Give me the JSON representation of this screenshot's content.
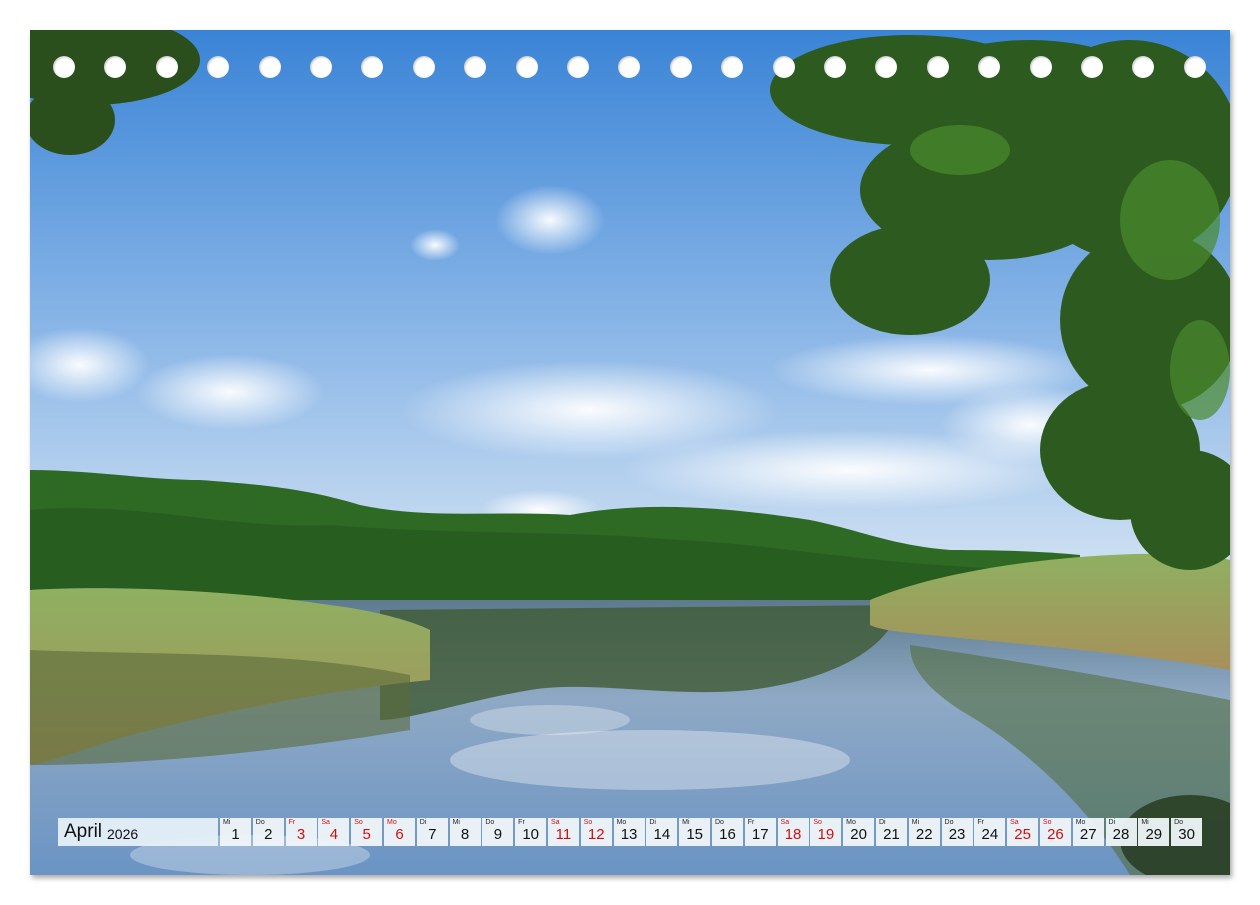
{
  "calendar": {
    "month": "April",
    "year": "2026",
    "days": [
      {
        "wd": "Mi",
        "d": "1"
      },
      {
        "wd": "Do",
        "d": "2"
      },
      {
        "wd": "Fr",
        "d": "3",
        "red": true
      },
      {
        "wd": "Sa",
        "d": "4",
        "red": true
      },
      {
        "wd": "So",
        "d": "5",
        "red": true
      },
      {
        "wd": "Mo",
        "d": "6",
        "red": true
      },
      {
        "wd": "Di",
        "d": "7"
      },
      {
        "wd": "Mi",
        "d": "8"
      },
      {
        "wd": "Do",
        "d": "9"
      },
      {
        "wd": "Fr",
        "d": "10"
      },
      {
        "wd": "Sa",
        "d": "11",
        "red": true
      },
      {
        "wd": "So",
        "d": "12",
        "red": true
      },
      {
        "wd": "Mo",
        "d": "13"
      },
      {
        "wd": "Di",
        "d": "14"
      },
      {
        "wd": "Mi",
        "d": "15"
      },
      {
        "wd": "Do",
        "d": "16"
      },
      {
        "wd": "Fr",
        "d": "17"
      },
      {
        "wd": "Sa",
        "d": "18",
        "red": true
      },
      {
        "wd": "So",
        "d": "19",
        "red": true
      },
      {
        "wd": "Mo",
        "d": "20"
      },
      {
        "wd": "Di",
        "d": "21"
      },
      {
        "wd": "Mi",
        "d": "22"
      },
      {
        "wd": "Do",
        "d": "23"
      },
      {
        "wd": "Fr",
        "d": "24"
      },
      {
        "wd": "Sa",
        "d": "25",
        "red": true
      },
      {
        "wd": "So",
        "d": "26",
        "red": true
      },
      {
        "wd": "Mo",
        "d": "27"
      },
      {
        "wd": "Di",
        "d": "28"
      },
      {
        "wd": "Mi",
        "d": "29"
      },
      {
        "wd": "Do",
        "d": "30"
      }
    ]
  },
  "binding_holes": 23,
  "colors": {
    "holiday_red": "#d01010",
    "sky_top": "#3d86d8",
    "forest": "#2f6a25"
  }
}
